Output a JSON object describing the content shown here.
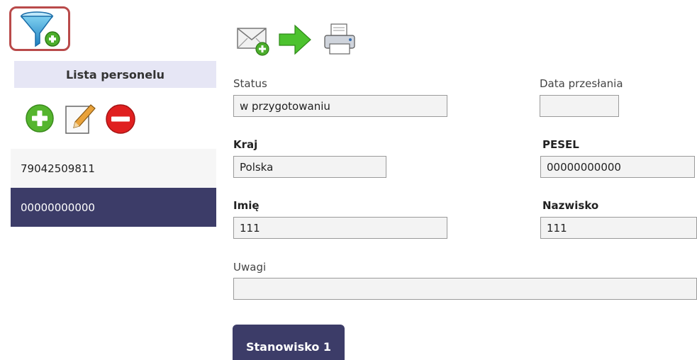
{
  "left_panel": {
    "title": "Lista personelu",
    "rows": [
      "79042509811",
      "00000000000"
    ],
    "selected_index": 1
  },
  "form": {
    "status_label": "Status",
    "status_value": "w przygotowaniu",
    "data_przeslania_label": "Data przesłania",
    "data_przeslania_value": "",
    "kraj_label": "Kraj",
    "kraj_value": "Polska",
    "pesel_label": "PESEL",
    "pesel_value": "00000000000",
    "imie_label": "Imię",
    "imie_value": "111",
    "nazwisko_label": "Nazwisko",
    "nazwisko_value": "111",
    "uwagi_label": "Uwagi",
    "uwagi_value": ""
  },
  "tabs": {
    "stanowisko": "Stanowisko 1"
  },
  "icons": {
    "filter": "filter-add-icon",
    "add": "add-icon",
    "edit": "edit-icon",
    "remove": "remove-icon",
    "email": "email-add-icon",
    "send": "send-arrow-icon",
    "print": "print-icon"
  },
  "colors": {
    "selected_row": "#3c3c68",
    "header_bg": "#e6e6f5",
    "highlight_border": "#b94a4a"
  }
}
